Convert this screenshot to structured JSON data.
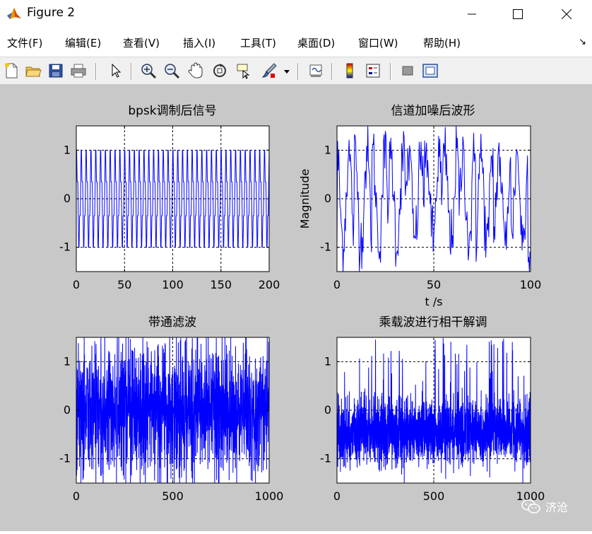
{
  "window": {
    "title": "Figure 2",
    "controls": {
      "minimize": "minimize",
      "maximize": "maximize",
      "close": "close"
    }
  },
  "menubar": {
    "items": [
      "文件(F)",
      "编辑(E)",
      "查看(V)",
      "插入(I)",
      "工具(T)",
      "桌面(D)",
      "窗口(W)",
      "帮助(H)"
    ],
    "extra": "↘"
  },
  "toolbar": {
    "icons": [
      "new-figure-icon",
      "open-file-icon",
      "save-icon",
      "print-icon",
      "edit-plot-arrow-icon",
      "zoom-in-icon",
      "zoom-out-icon",
      "pan-hand-icon",
      "rotate-3d-icon",
      "data-cursor-icon",
      "brush-icon",
      "brush-dropdown-icon",
      "link-plot-icon",
      "insert-colorbar-icon",
      "insert-legend-icon",
      "hide-plot-tools-icon",
      "show-plot-tools-icon"
    ]
  },
  "watermark": {
    "text": "济沧"
  },
  "chart_data": [
    {
      "type": "line",
      "title": "bpsk调制后信号",
      "xlabel": "",
      "ylabel": "",
      "xlim": [
        0,
        200
      ],
      "ylim": [
        -1.5,
        1.5
      ],
      "xticks": [
        "0",
        "50",
        "100",
        "150",
        "200"
      ],
      "yticks": [
        "-1",
        "0",
        "1"
      ],
      "grid": true,
      "series": [
        {
          "color": "#0000ff",
          "description": "square-like carrier with amplitude ±1, about 40 cycles over 0–200"
        }
      ]
    },
    {
      "type": "line",
      "title": "信道加噪后波形",
      "xlabel": "t /s",
      "ylabel": "Magnitude",
      "xlim": [
        0,
        100
      ],
      "ylim": [
        -1.5,
        1.5
      ],
      "xticks": [
        "0",
        "50",
        "100"
      ],
      "yticks": [
        "-1",
        "0",
        "1"
      ],
      "grid": true,
      "series": [
        {
          "color": "#0000ff",
          "description": "noisy bpsk signal clipped at ±1.5"
        }
      ]
    },
    {
      "type": "line",
      "title": "带通滤波",
      "xlabel": "",
      "ylabel": "",
      "xlim": [
        0,
        1000
      ],
      "ylim": [
        -1.5,
        1.5
      ],
      "xticks": [
        "0",
        "500",
        "1000"
      ],
      "yticks": [
        "-1",
        "0",
        "1"
      ],
      "grid": true,
      "series": [
        {
          "color": "#0000ff",
          "description": "dense oscillation filling roughly ±1.5"
        }
      ]
    },
    {
      "type": "line",
      "title": "乘载波进行相干解调",
      "xlabel": "",
      "ylabel": "",
      "xlim": [
        0,
        1000
      ],
      "ylim": [
        -1.5,
        1.5
      ],
      "xticks": [
        "0",
        "500",
        "1000"
      ],
      "yticks": [
        "-1",
        "0",
        "1"
      ],
      "grid": true,
      "series": [
        {
          "color": "#0000ff",
          "description": "dense signal mostly between -1 and 0 with positive spikes"
        }
      ]
    }
  ]
}
